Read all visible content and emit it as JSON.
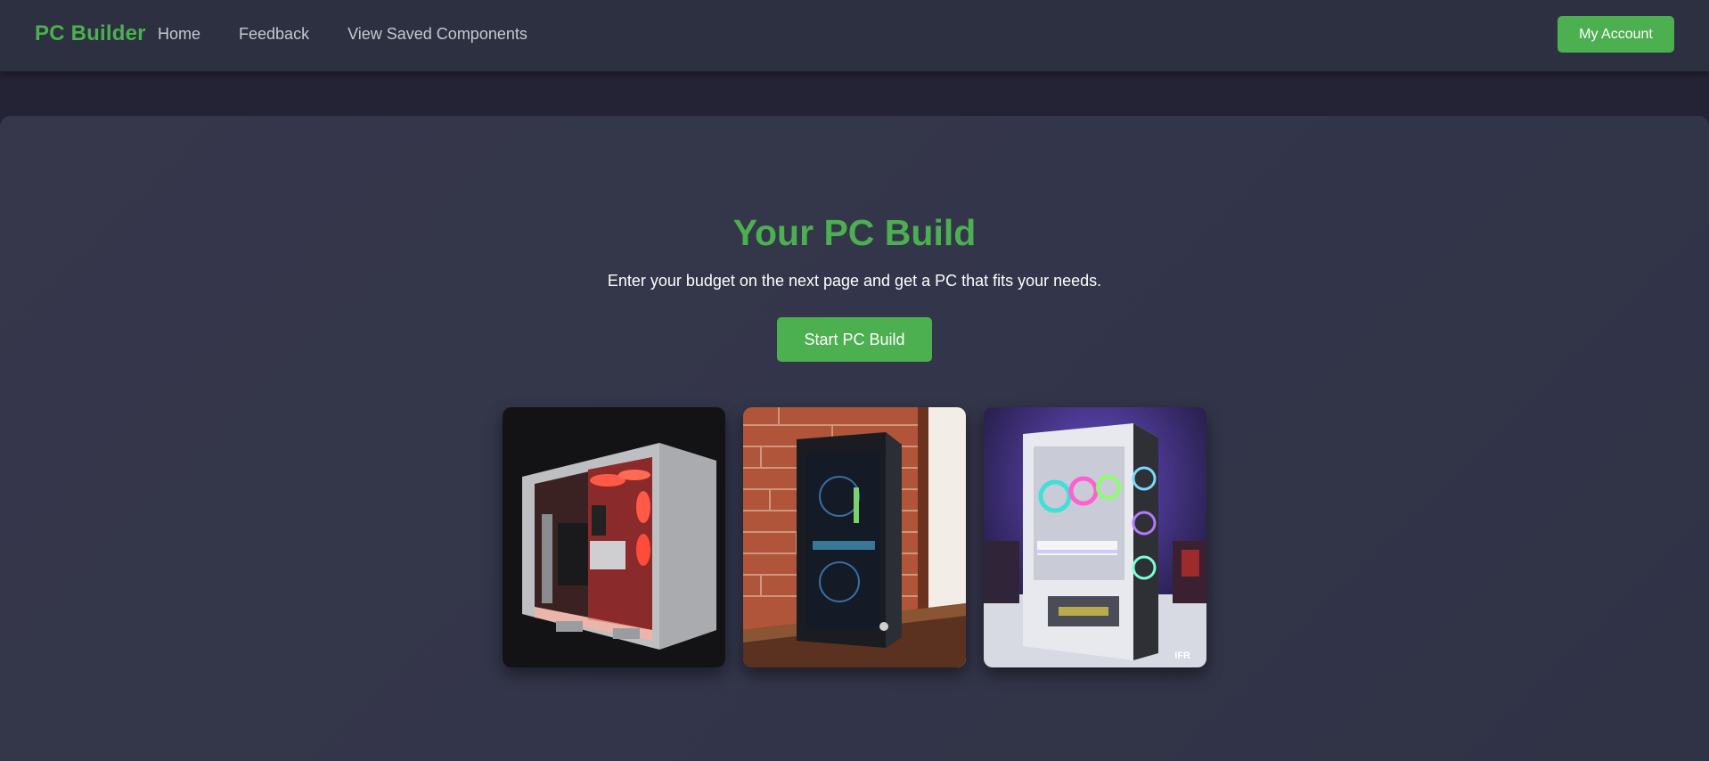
{
  "nav": {
    "brand": "PC Builder",
    "links": [
      "Home",
      "Feedback",
      "View Saved Components"
    ],
    "account_label": "My Account"
  },
  "hero": {
    "title": "Your PC Build",
    "subtitle": "Enter your budget on the next page and get a PC that fits your needs.",
    "cta_label": "Start PC Build"
  },
  "gallery": {
    "watermark": "IFR"
  },
  "colors": {
    "accent": "#4caf50",
    "navbar_bg": "#2d3040",
    "panel_bg": "#36374b",
    "page_bg": "#232335"
  }
}
